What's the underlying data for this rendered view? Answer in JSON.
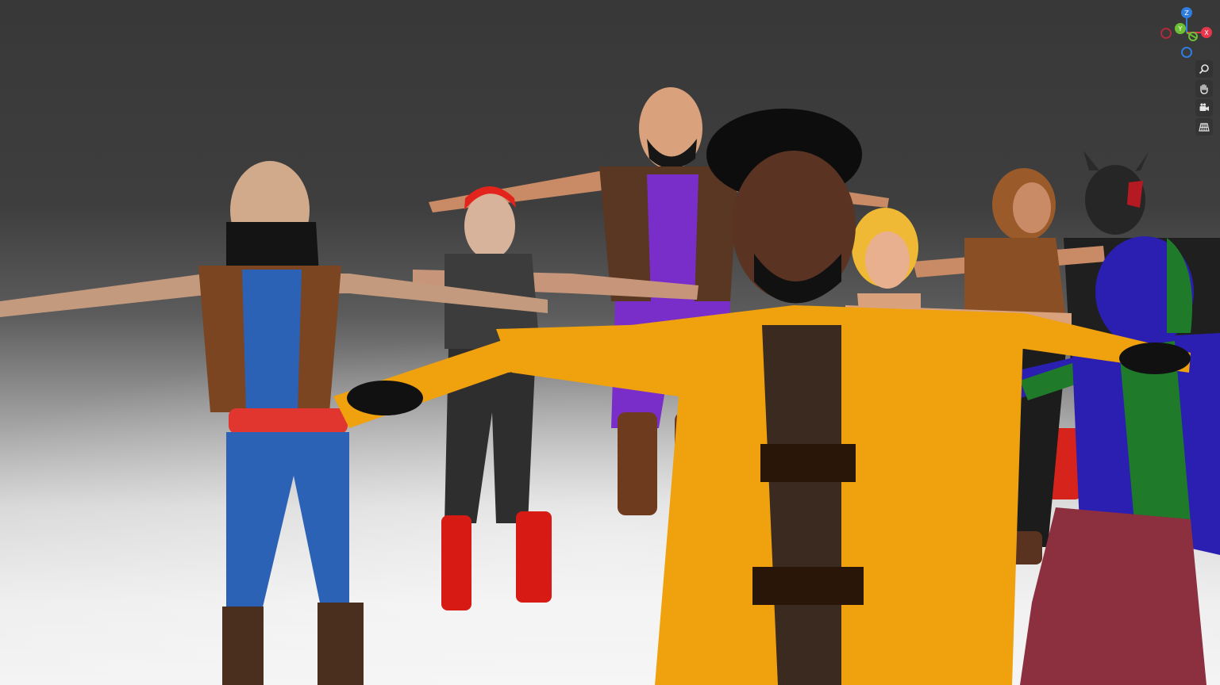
{
  "viewport": {
    "background_top": "#383838",
    "background_floor": "#f2f2f2"
  },
  "gizmo": {
    "axes": [
      {
        "label": "Z",
        "color": "#2f7de1"
      },
      {
        "label": "Y",
        "color": "#6fbf35"
      },
      {
        "label": "X",
        "color": "#e8364c"
      }
    ]
  },
  "navigation": [
    {
      "name": "zoom",
      "icon": "magnifier-icon"
    },
    {
      "name": "pan",
      "icon": "hand-icon"
    },
    {
      "name": "camera",
      "icon": "camera-icon"
    },
    {
      "name": "perspective",
      "icon": "grid-icon"
    }
  ],
  "characters": [
    {
      "name": "masked-fighter",
      "colors": {
        "shirt": "#2b62b5",
        "vest": "#7a4520",
        "belt": "#e0362f",
        "mask": "#141414"
      }
    },
    {
      "name": "red-haired-knight",
      "colors": {
        "hair": "#e3241c",
        "armor": "#3c3c3c",
        "boots": "#d81a14"
      }
    },
    {
      "name": "bald-bruiser",
      "colors": {
        "shirt": "#7a2ec9",
        "vest": "#5a3722",
        "boots": "#6e3b1e"
      }
    },
    {
      "name": "afro-monk",
      "colors": {
        "robe": "#f0a10e",
        "inner": "#3a2a20",
        "hair": "#0d0d0d",
        "skin": "#5a3322"
      }
    },
    {
      "name": "blonde-woman",
      "colors": {
        "hair": "#f0b935",
        "pants": "#1e1e1e",
        "skirt": "#d6342a"
      }
    },
    {
      "name": "hooded-rogue",
      "colors": {
        "hood": "#9a5a2a",
        "pants": "#1c1c1c"
      }
    },
    {
      "name": "horned-warrior",
      "colors": {
        "helmet": "#262626",
        "paint": "#b51a22"
      }
    },
    {
      "name": "tusked-orc",
      "colors": {
        "skin_blue": "#2a1fb0",
        "skin_green": "#1f7a2a",
        "skirt": "#8c2f3e"
      }
    }
  ]
}
